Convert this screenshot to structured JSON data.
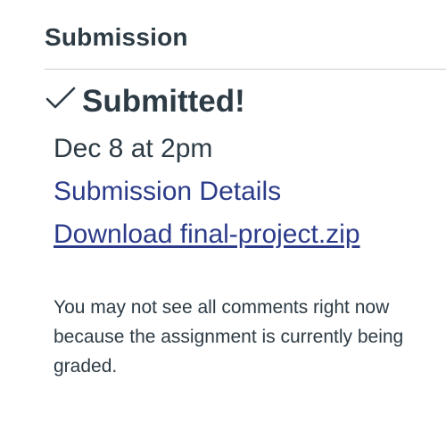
{
  "submission": {
    "heading": "Submission",
    "status": {
      "icon": "checkmark-icon",
      "label": "Submitted!"
    },
    "date": "Dec 8 at 2pm",
    "details_link": "Submission Details",
    "download_link": "Download final-project.zip",
    "notice": "You may not see all comments right now because the assignment is currently being graded."
  },
  "colors": {
    "text": "#2d3b45",
    "link": "#2b3b8a",
    "divider": "#c7cdd1"
  }
}
